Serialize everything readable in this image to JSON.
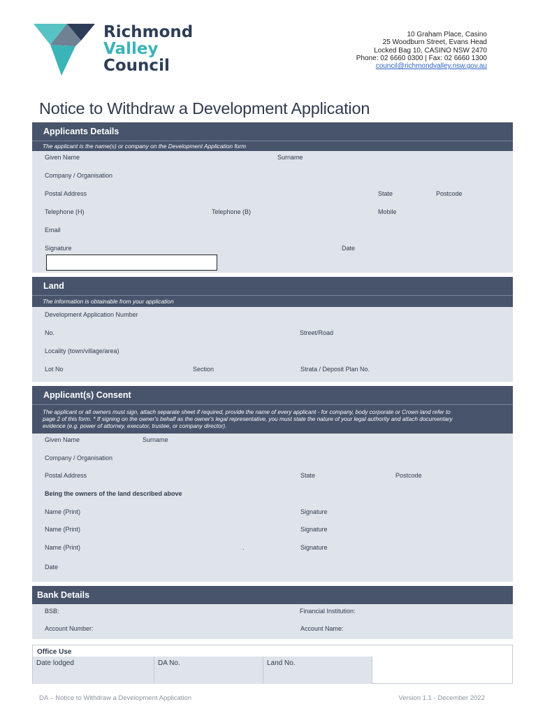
{
  "logo": {
    "line1": "Richmond",
    "line2": "Valley",
    "line3": "Council"
  },
  "address": {
    "line1": "10 Graham Place, Casino",
    "line2": "25 Woodburn Street, Evans Head",
    "line3": "Locked Bag 10, CASINO  NSW  2470",
    "line4": "Phone: 02 6660 0300  |  Fax: 02 6660 1300",
    "email": "council@richmondvalley.nsw.gov.au"
  },
  "title": "Notice to Withdraw a Development Application",
  "applicants": {
    "heading": "Applicants Details",
    "note": "The applicant is the name(s) or company on the Development Application form",
    "given_name": "Given Name",
    "surname": "Surname",
    "company": "Company / Organisation",
    "postal": "Postal Address",
    "state": "State",
    "postcode": "Postcode",
    "tel_h": "Telephone (H)",
    "tel_b": "Telephone (B)",
    "mobile": "Mobile",
    "email": "Email",
    "signature": "Signature",
    "date": "Date"
  },
  "land": {
    "heading": "Land",
    "note": "The information is obtainable from your application",
    "da_number": "Development Application Number",
    "no": "No.",
    "street": "Street/Road",
    "locality": "Locality (town/village/area)",
    "lot": "Lot No",
    "section": "Section",
    "strata": "Strata / Deposit Plan No."
  },
  "consent": {
    "heading": "Applicant(s) Consent",
    "note_line1": "The applicant or all owners must sign, attach separate sheet if required, provide the name of every applicant - for company, body corporate or Crown land refer to",
    "note_line2": "page 2 of this form. * If signing on the owner's behalf as the owner's legal representative, you must state the nature of your legal authority and attach documentary",
    "note_line3": "evidence (e.g. power of attorney, executor, trustee, or company director).",
    "given_name": "Given Name",
    "surname": "Surname",
    "company": "Company / Organisation",
    "postal": "Postal Address",
    "state": "State",
    "postcode": "Postcode",
    "owners": "Being the owners of the land described above",
    "name_print": "Name (Print)",
    "signature": "Signature",
    "dot": ".",
    "date": "Date"
  },
  "bank": {
    "heading": "Bank Details",
    "bsb": "BSB:",
    "institution": "Financial Institution:",
    "account_number": "Account Number:",
    "account_name": "Account Name:"
  },
  "office": {
    "title": "Office Use",
    "date_lodged": "Date lodged",
    "da_no": "DA No.",
    "land_no": "Land No."
  },
  "footer": {
    "left": "DA – Notice to Withdraw a Development Application",
    "right": "Version 1.1 - December 2022"
  },
  "colors": {
    "header": "#47546b",
    "panel": "#dfe3ea",
    "teal": "#3bb4b8",
    "navy": "#2d3d57"
  }
}
